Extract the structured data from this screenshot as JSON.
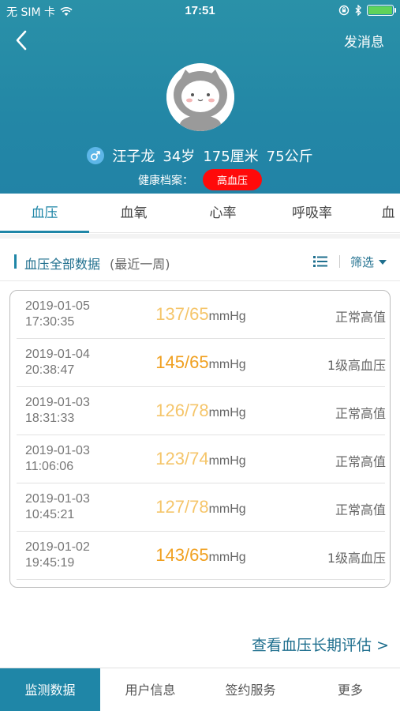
{
  "status_bar": {
    "carrier": "无 SIM 卡",
    "time": "17:51"
  },
  "header": {
    "send_message_label": "发消息",
    "user_name": "汪子龙",
    "age": "34岁",
    "height": "175厘米",
    "weight": "75公斤",
    "health_record_label": "健康档案：",
    "health_tag": "高血压",
    "colors": {
      "accent": "#1f86a7",
      "badge": "#ff0a0a"
    }
  },
  "tabs": [
    {
      "label": "血压",
      "active": true
    },
    {
      "label": "血氧",
      "active": false
    },
    {
      "label": "心率",
      "active": false
    },
    {
      "label": "呼吸率",
      "active": false
    },
    {
      "label": "血",
      "active": false
    }
  ],
  "section": {
    "title": "血压全部数据",
    "subtitle": "(最近一周)",
    "filter_label": "筛选"
  },
  "records": [
    {
      "date": "2019-01-05",
      "time": "17:30:35",
      "value": "137/65",
      "unit": "mmHg",
      "status": "正常高值",
      "level": "normal-high"
    },
    {
      "date": "2019-01-04",
      "time": "20:38:47",
      "value": "145/65",
      "unit": "mmHg",
      "status": "1级高血压",
      "level": "hypertension"
    },
    {
      "date": "2019-01-03",
      "time": "18:31:33",
      "value": "126/78",
      "unit": "mmHg",
      "status": "正常高值",
      "level": "normal-high"
    },
    {
      "date": "2019-01-03",
      "time": "11:06:06",
      "value": "123/74",
      "unit": "mmHg",
      "status": "正常高值",
      "level": "normal-high"
    },
    {
      "date": "2019-01-03",
      "time": "10:45:21",
      "value": "127/78",
      "unit": "mmHg",
      "status": "正常高值",
      "level": "normal-high"
    },
    {
      "date": "2019-01-02",
      "time": "19:45:19",
      "value": "143/65",
      "unit": "mmHg",
      "status": "1级高血压",
      "level": "hypertension"
    }
  ],
  "value_colors": {
    "normal-high": "#f5c56a",
    "hypertension": "#f0a020"
  },
  "long_term_link": "查看血压长期评估 >",
  "bottom_nav": [
    {
      "label": "监测数据",
      "active": true
    },
    {
      "label": "用户信息",
      "active": false
    },
    {
      "label": "签约服务",
      "active": false
    },
    {
      "label": "更多",
      "active": false
    }
  ]
}
